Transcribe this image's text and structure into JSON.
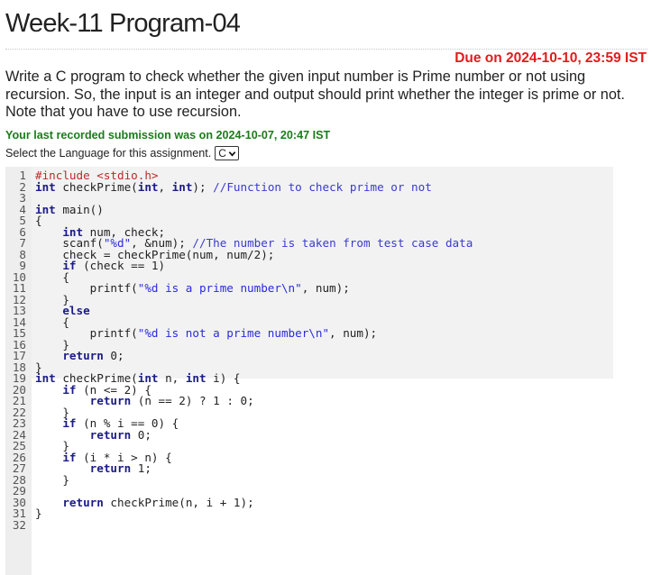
{
  "page": {
    "title": "Week-11 Program-04",
    "due": "Due on 2024-10-10, 23:59 IST",
    "description": "Write a C program to check whether the given input number is Prime number or not using recursion. So, the input is an integer and output should print whether the integer is prime or not. Note that you have to use recursion.",
    "last_submission": "Your last recorded submission was on 2024-10-07, 20:47 IST",
    "language_prompt": "Select the Language for this assignment.",
    "language_selected": "C"
  },
  "colors": {
    "due": "#e31b1b",
    "submission": "#1a7d1a",
    "keyword": "#1b1b8a",
    "string": "#2a2ae0",
    "preprocessor": "#c02828"
  },
  "icons": {
    "language_dropdown": "chevron-down-icon"
  },
  "code_lines": [
    "#include <stdio.h>",
    "int checkPrime(int, int); //Function to check prime or not",
    "",
    "int main()",
    "{",
    "    int num, check;",
    "    scanf(\"%d\", &num); //The number is taken from test case data",
    "    check = checkPrime(num, num/2);",
    "    if (check == 1)",
    "    {",
    "        printf(\"%d is a prime number\\n\", num);",
    "    }",
    "    else",
    "    {",
    "        printf(\"%d is not a prime number\\n\", num);",
    "    }",
    "    return 0;",
    "}",
    "int checkPrime(int n, int i) {",
    "    if (n <= 2) {",
    "        return (n == 2) ? 1 : 0;",
    "    }",
    "    if (n % i == 0) {",
    "        return 0;",
    "    }",
    "    if (i * i > n) {",
    "        return 1;",
    "    }",
    "",
    "    return checkPrime(n, i + 1);",
    "}",
    ""
  ]
}
